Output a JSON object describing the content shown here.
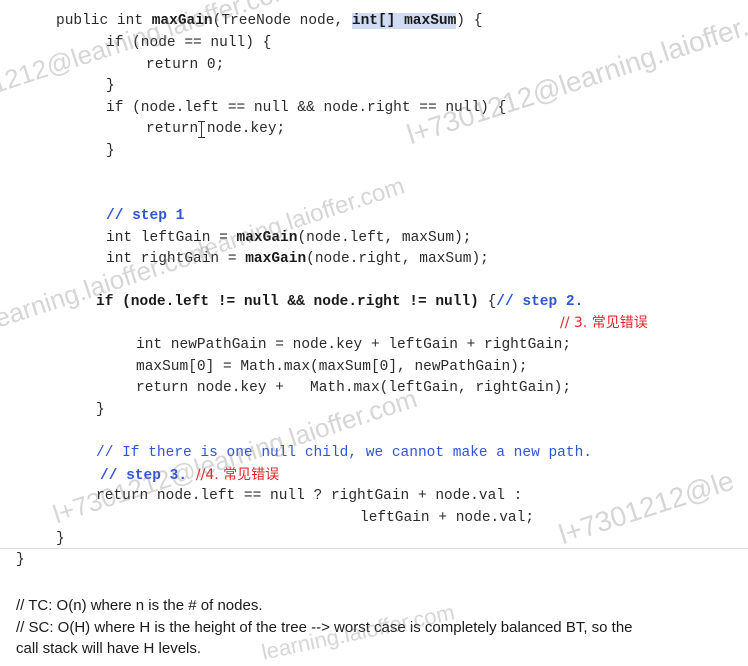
{
  "code": {
    "sig_pre": "public int ",
    "sig_fn": "maxGain",
    "sig_mid": "(TreeNode node, ",
    "sig_hl": "int[] maxSum",
    "sig_post": ") {",
    "if_null": "if (node == null) {",
    "return_zero": "return 0;",
    "close_brace": "}",
    "if_leaf": "if (node.left == null && node.right == null) {",
    "return_key": "return node.key;",
    "step1_comment": "// step 1",
    "left_gain_pre": "int leftGain = ",
    "left_gain_fn": "maxGain",
    "left_gain_args": "(node.left, maxSum);",
    "right_gain_pre": "int rightGain = ",
    "right_gain_fn": "maxGain",
    "right_gain_args": "(node.right, maxSum);",
    "if_both": "if (node.left != null && node.right != null)",
    "if_both_brace": " {",
    "step2_comment": "// step 2.",
    "note3": "// 3. 常见错误",
    "new_path": "int newPathGain = node.key + leftGain + rightGain;",
    "max_sum": "maxSum[0] = Math.max(maxSum[0], newPathGain);",
    "return_max": "return node.key +   Math.max(leftGain, rightGain);",
    "if_one_comment": "// If there is one null child, we cannot make a new path.",
    "step3_comment": "// step 3.",
    "note4": "  //4. 常见错误",
    "return_one_a": "return node.left == null ? rightGain + node.val :",
    "return_one_b": "leftGain + node.val;"
  },
  "notes": {
    "tc": "// TC: O(n) where n is the # of nodes.",
    "sc1": "// SC: O(H) where H is the height of the tree --> worst case is completely balanced BT, so the",
    "sc2": "call stack will have H levels."
  },
  "watermark": {
    "a": "l+7301212@learning.laioffer.com",
    "b": "1212@learning.laioffer.com",
    "c": "learning.laioffer.com",
    "d": "l+7301212@le"
  },
  "colors": {
    "comment": "#2f56d9",
    "highlight": "#cfdcf4",
    "red_note": "#e0262b"
  }
}
